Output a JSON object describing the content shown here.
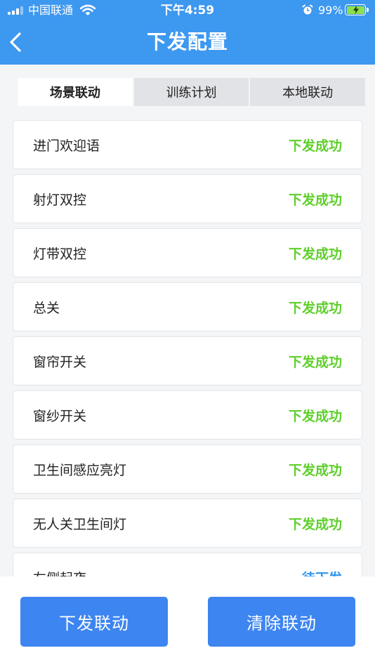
{
  "status_bar": {
    "carrier": "中国联通",
    "time": "下午4:59",
    "battery": "99%",
    "icons": [
      "signal-icon",
      "wifi-icon",
      "alarm-icon",
      "battery-icon"
    ]
  },
  "nav": {
    "title": "下发配置",
    "back_icon": "chevron-left-icon"
  },
  "tabs": [
    {
      "label": "场景联动",
      "active": true
    },
    {
      "label": "训练计划",
      "active": false
    },
    {
      "label": "本地联动",
      "active": false
    }
  ],
  "items": [
    {
      "name": "进门欢迎语",
      "status": "下发成功",
      "state": "ok"
    },
    {
      "name": "射灯双控",
      "status": "下发成功",
      "state": "ok"
    },
    {
      "name": "灯带双控",
      "status": "下发成功",
      "state": "ok"
    },
    {
      "name": "总关",
      "status": "下发成功",
      "state": "ok"
    },
    {
      "name": "窗帘开关",
      "status": "下发成功",
      "state": "ok"
    },
    {
      "name": "窗纱开关",
      "status": "下发成功",
      "state": "ok"
    },
    {
      "name": "卫生间感应亮灯",
      "status": "下发成功",
      "state": "ok"
    },
    {
      "name": "无人关卫生间灯",
      "status": "下发成功",
      "state": "ok"
    },
    {
      "name": "左侧起夜",
      "status": "待下发",
      "state": "pending"
    }
  ],
  "actions": {
    "dispatch_label": "下发联动",
    "clear_label": "清除联动"
  },
  "colors": {
    "header": "#3d98f0",
    "button": "#3d85f0",
    "success": "#5ecf2a",
    "pending": "#2e95ee"
  }
}
